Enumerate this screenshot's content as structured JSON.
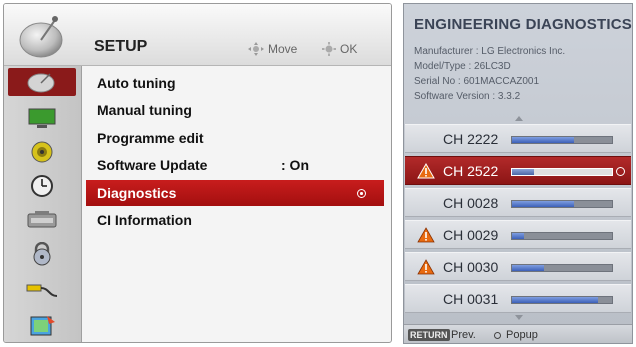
{
  "setup": {
    "title": "SETUP",
    "move_hint": "Move",
    "ok_hint": "OK",
    "header_icon": "satellite-dish-icon",
    "sidebar": [
      {
        "icon": "satellite-dish-icon",
        "active": true
      },
      {
        "icon": "monitor-icon",
        "active": false
      },
      {
        "icon": "speaker-icon",
        "active": false
      },
      {
        "icon": "clock-icon",
        "active": false
      },
      {
        "icon": "option-icon",
        "active": false
      },
      {
        "icon": "lock-icon",
        "active": false
      },
      {
        "icon": "cable-icon",
        "active": false
      },
      {
        "icon": "photo-icon",
        "active": false
      }
    ],
    "menu": [
      {
        "label": "Auto tuning"
      },
      {
        "label": "Manual tuning"
      },
      {
        "label": "Programme edit"
      },
      {
        "label": "Software Update",
        "value": ": On"
      },
      {
        "label": "Diagnostics",
        "selected": true
      },
      {
        "label": "CI Information"
      }
    ]
  },
  "engineering": {
    "title": "ENGINEERING DIAGNOSTICS",
    "info": [
      "Manufacturer : LG Electronics Inc.",
      "Model/Type : 26LC3D",
      "Serial No : 601MACCAZ001",
      "Software Version : 3.3.2"
    ],
    "channels": [
      {
        "label": "CH 2222",
        "warning": false,
        "level": 0.62,
        "selected": false
      },
      {
        "label": "CH 2522",
        "warning": true,
        "level": 0.22,
        "selected": true
      },
      {
        "label": "CH 0028",
        "warning": false,
        "level": 0.62,
        "selected": false
      },
      {
        "label": "CH 0029",
        "warning": true,
        "level": 0.12,
        "selected": false
      },
      {
        "label": "CH 0030",
        "warning": true,
        "level": 0.32,
        "selected": false
      },
      {
        "label": "CH 0031",
        "warning": false,
        "level": 0.86,
        "selected": false
      }
    ],
    "footer": {
      "return_key": "RETURN",
      "prev_label": "Prev.",
      "popup_label": "Popup"
    }
  },
  "colors": {
    "selected_red": "#b81818",
    "bar_blue": "#4a6cc0",
    "warning_orange": "#e86a10"
  }
}
